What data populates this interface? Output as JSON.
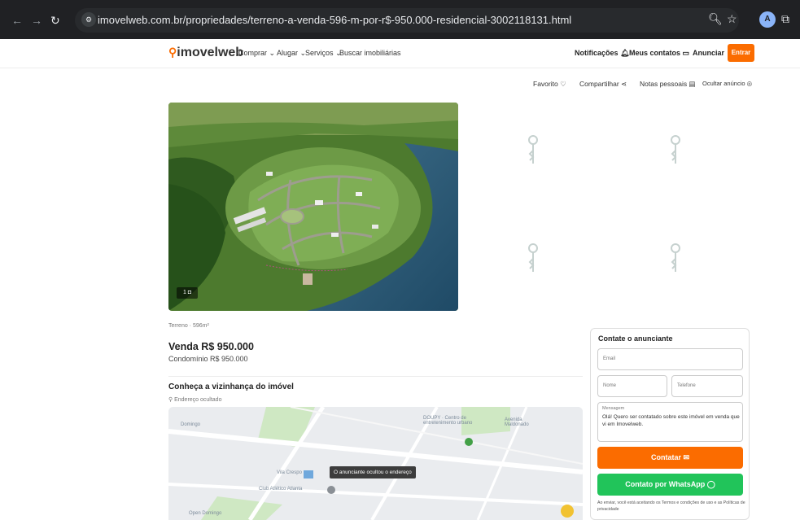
{
  "browser": {
    "url": "imovelweb.com.br/propriedades/terreno-a-venda-596-m-por-r$-950.000-residencial-3002118131.html",
    "profile_initial": "A"
  },
  "header": {
    "logo": "imovelweb",
    "menu": [
      "Comprar",
      "Alugar",
      "Serviços",
      "Buscar imobiliárias"
    ],
    "notificacoes": "Notificações",
    "meus_contatos": "Meus contatos",
    "anunciar": "Anunciar",
    "entrar": "Entrar"
  },
  "actions": {
    "favorito": "Favorito",
    "compartilhar": "Compartilhar",
    "notas": "Notas pessoais",
    "ocultar": "Ocultar anúncio"
  },
  "gallery": {
    "photo_count": "1"
  },
  "listing": {
    "type_area": "Terreno · 596m²",
    "price": "Venda R$ 950.000",
    "condominio": "Condomínio R$ 950.000",
    "neighborhood_title": "Conheça a vizinhança do imóvel",
    "address": "Endereço ocultado"
  },
  "map": {
    "tooltip": "O anunciante ocultou o endereço",
    "labels": [
      "Domingo",
      "DOUPY · Centro de entretenimento urbano",
      "Avenida Maldonado",
      "Vila Crespo",
      "Club Atlético Atlanta",
      "Open Domingo"
    ]
  },
  "contact": {
    "title": "Contate o anunciante",
    "email_placeholder": "Email",
    "nome_placeholder": "Nome",
    "telefone_placeholder": "Telefone",
    "mensagem_label": "Mensagem",
    "mensagem_text": "Olá! Quero ser contatado sobre este imóvel em venda que vi em Imovelweb.",
    "contatar": "Contatar",
    "whatsapp": "Contato por WhatsApp",
    "legal": "Ao enviar, você está aceitando os Termos e condições de uso e as Políticas de privacidade"
  },
  "colors": {
    "brand": "#fb6c00",
    "whatsapp": "#21c45a",
    "chrome_bg": "#202124"
  }
}
